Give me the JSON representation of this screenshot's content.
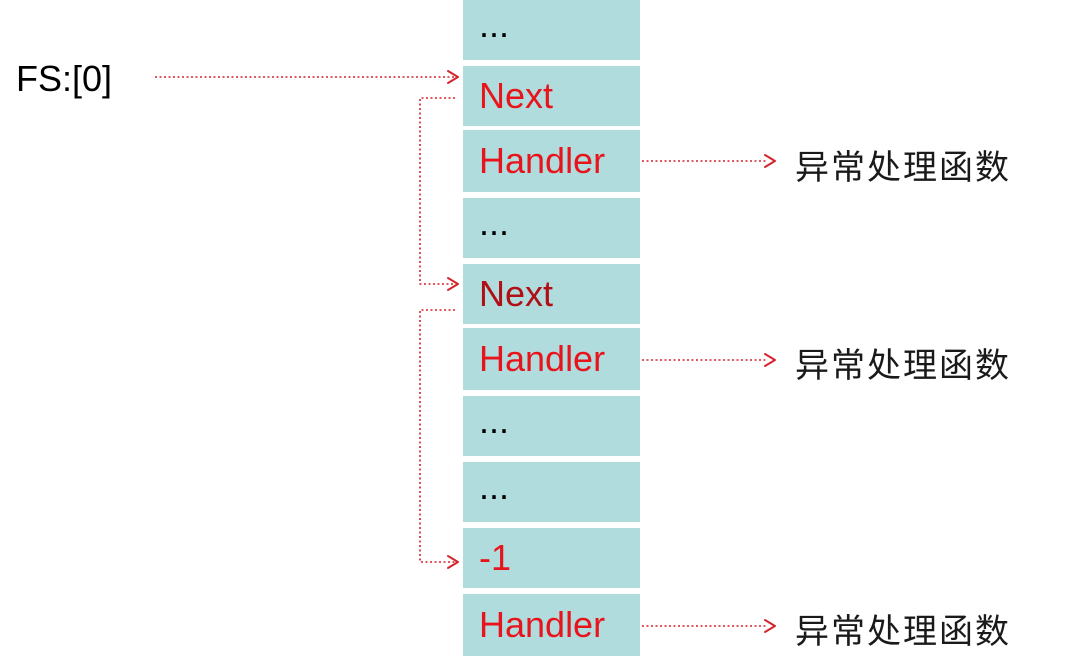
{
  "register_label": "FS:[0]",
  "stack_cells": [
    {
      "text": "...",
      "style": "plain"
    },
    {
      "text": "Next",
      "style": "red"
    },
    {
      "text": "Handler",
      "style": "red"
    },
    {
      "text": "...",
      "style": "plain"
    },
    {
      "text": "Next",
      "style": "dark"
    },
    {
      "text": "Handler",
      "style": "red"
    },
    {
      "text": "...",
      "style": "plain"
    },
    {
      "text": "...",
      "style": "plain"
    },
    {
      "text": "-1",
      "style": "red"
    },
    {
      "text": "Handler",
      "style": "red"
    }
  ],
  "handler_targets": [
    {
      "text": "异常处理函数",
      "cell_index": 2
    },
    {
      "text": "异常处理函数",
      "cell_index": 5
    },
    {
      "text": "异常处理函数",
      "cell_index": 9
    }
  ],
  "next_links": [
    {
      "from": 1,
      "to": 4
    },
    {
      "from": 4,
      "to": 8
    }
  ],
  "colors": {
    "cell_fill": "#b0dcde",
    "pointer": "#d4242b",
    "text_red": "#e8141c",
    "text_dark_red": "#b00f14"
  }
}
